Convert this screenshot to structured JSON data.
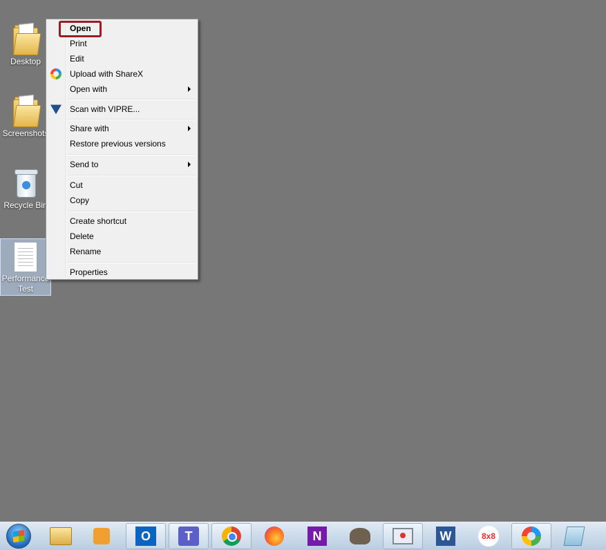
{
  "desktop": {
    "icons": [
      {
        "label": "Desktop"
      },
      {
        "label": "Screenshots"
      },
      {
        "label": "Recycle Bin"
      },
      {
        "label_line1": "Performance",
        "label_line2": "Test"
      }
    ]
  },
  "context_menu": {
    "items": {
      "open": "Open",
      "print": "Print",
      "edit": "Edit",
      "upload_sharex": "Upload with ShareX",
      "open_with": "Open with",
      "scan_vipre": "Scan with VIPRE...",
      "share_with": "Share with",
      "restore_versions": "Restore previous versions",
      "send_to": "Send to",
      "cut": "Cut",
      "copy": "Copy",
      "create_shortcut": "Create shortcut",
      "delete": "Delete",
      "rename": "Rename",
      "properties": "Properties"
    },
    "highlight_color": "#9b1b25"
  },
  "taskbar": {
    "apps": [
      "start-button",
      "file-explorer",
      "media-player",
      "outlook",
      "teams",
      "chrome",
      "firefox",
      "onenote",
      "gimp",
      "screen-recorder",
      "word",
      "8x8",
      "sharex",
      "notepad"
    ],
    "labels": {
      "outlook": "O",
      "teams": "T",
      "onenote": "N",
      "word": "W",
      "eightbyeight": "8x8"
    }
  }
}
